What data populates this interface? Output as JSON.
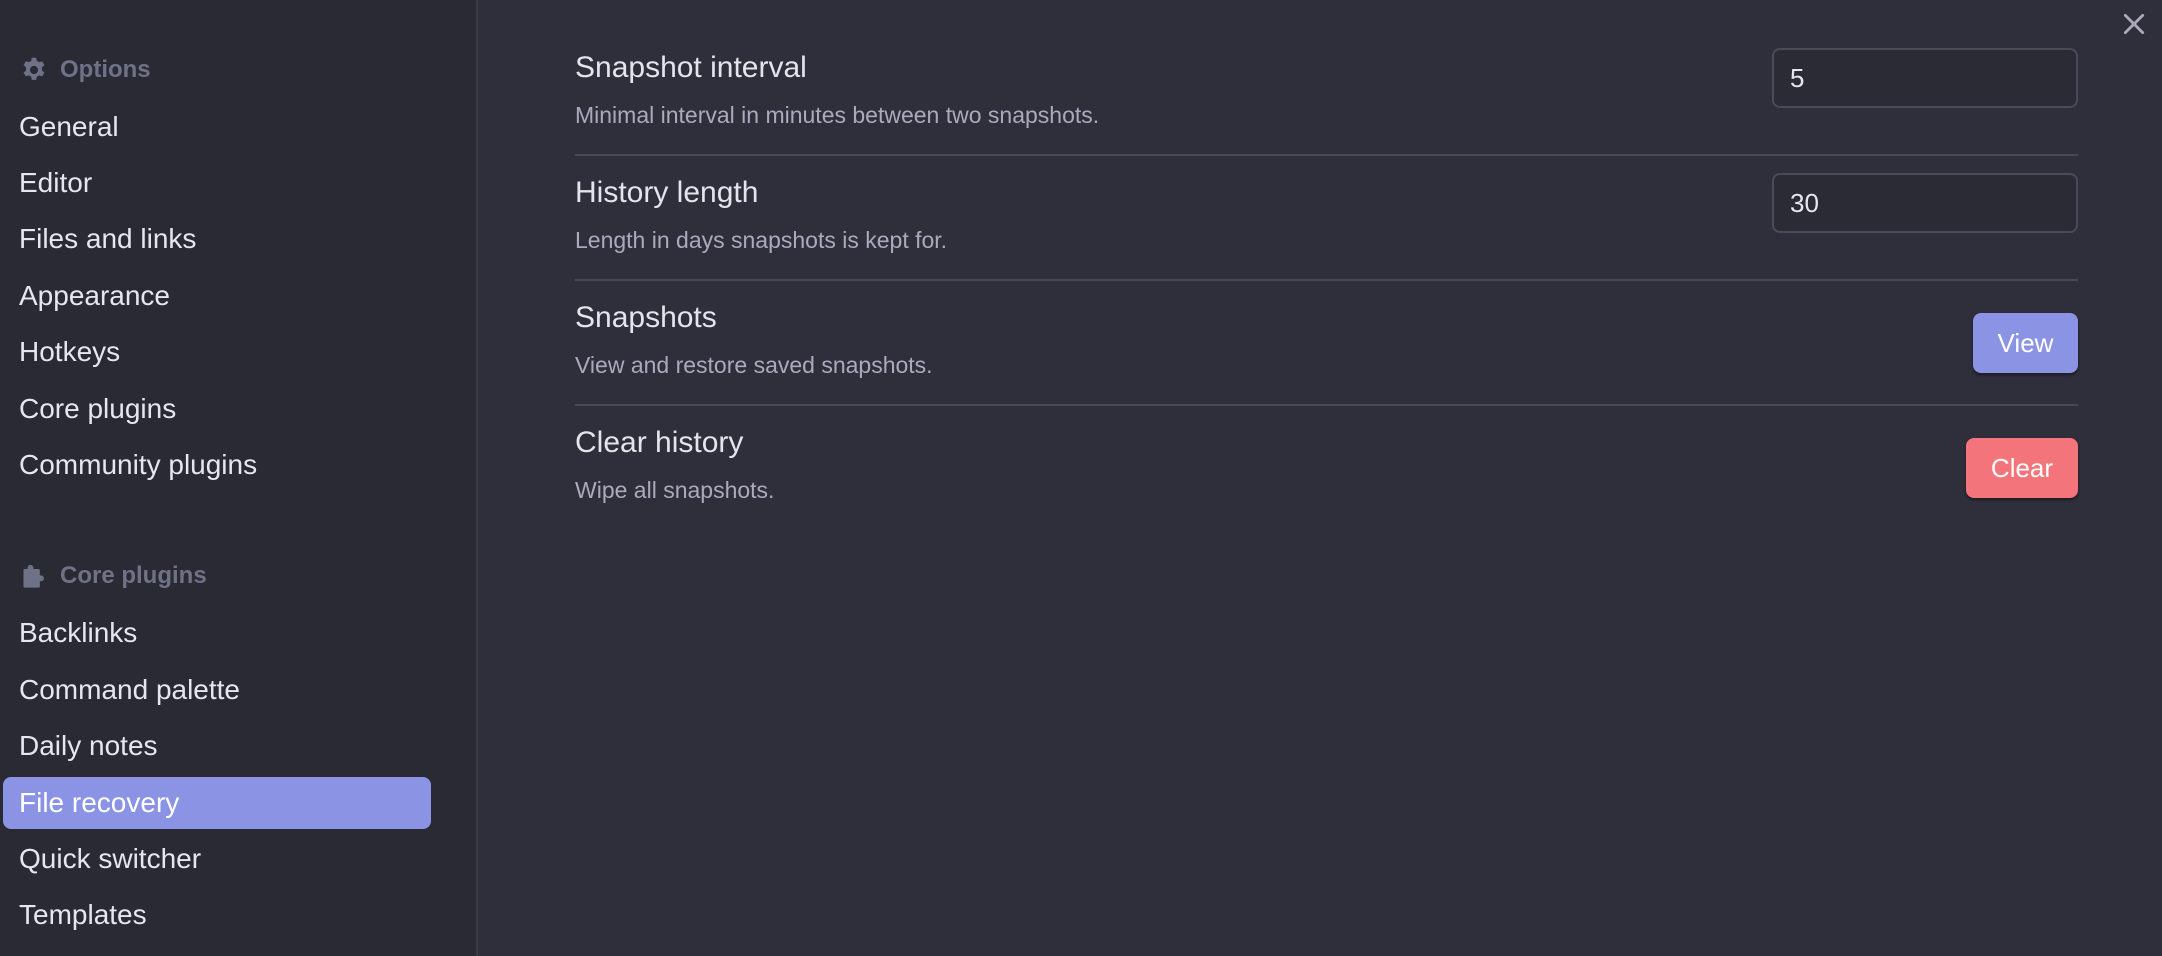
{
  "sidebar": {
    "options_header": "Options",
    "options_items": [
      {
        "label": "General"
      },
      {
        "label": "Editor"
      },
      {
        "label": "Files and links"
      },
      {
        "label": "Appearance"
      },
      {
        "label": "Hotkeys"
      },
      {
        "label": "Core plugins"
      },
      {
        "label": "Community plugins"
      }
    ],
    "core_plugins_header": "Core plugins",
    "core_plugins_items": [
      {
        "label": "Backlinks"
      },
      {
        "label": "Command palette"
      },
      {
        "label": "Daily notes"
      },
      {
        "label": "File recovery",
        "active": true
      },
      {
        "label": "Quick switcher"
      },
      {
        "label": "Templates"
      }
    ]
  },
  "settings": {
    "snapshot_interval": {
      "name": "Snapshot interval",
      "desc": "Minimal interval in minutes between two snapshots.",
      "value": "5"
    },
    "history_length": {
      "name": "History length",
      "desc": "Length in days snapshots is kept for.",
      "value": "30"
    },
    "snapshots": {
      "name": "Snapshots",
      "desc": "View and restore saved snapshots.",
      "button": "View"
    },
    "clear_history": {
      "name": "Clear history",
      "desc": "Wipe all snapshots.",
      "button": "Clear"
    }
  },
  "colors": {
    "background": "#2f2f3c",
    "sidebar_background": "#2a2a35",
    "accent": "#8b94e4",
    "danger": "#f3747a"
  },
  "icons": {
    "options": "gear-icon",
    "core_plugins": "puzzle-icon",
    "close": "close-icon"
  }
}
